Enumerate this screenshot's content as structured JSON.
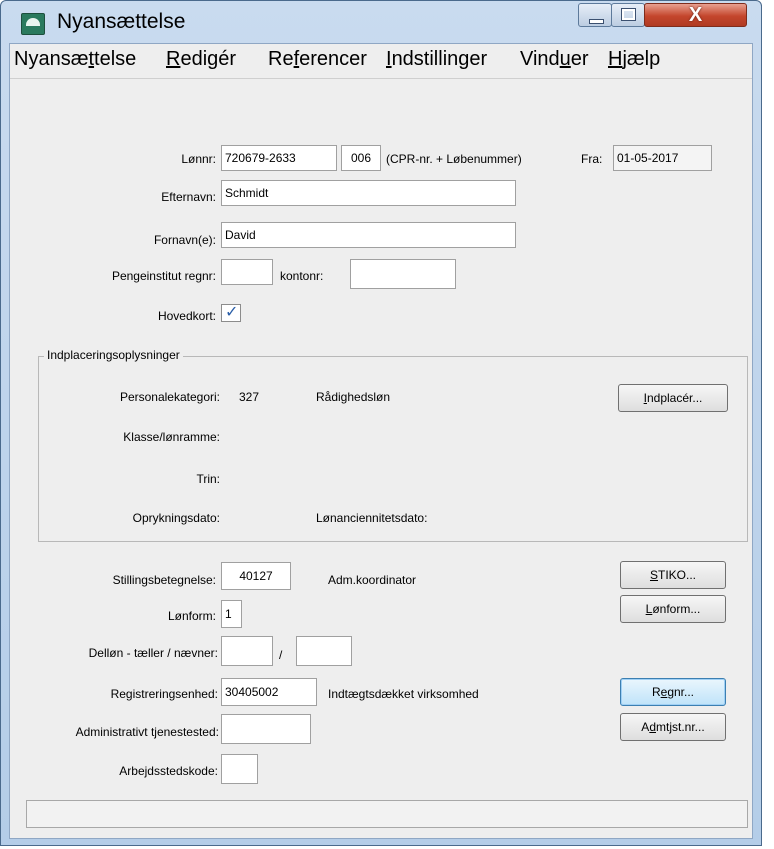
{
  "window": {
    "title": "Nyansættelse"
  },
  "menu": {
    "items": [
      {
        "pre": "Nyansæ",
        "key": "t",
        "post": "telse"
      },
      {
        "pre": "",
        "key": "R",
        "post": "edigér"
      },
      {
        "pre": "Re",
        "key": "f",
        "post": "erencer"
      },
      {
        "pre": "",
        "key": "I",
        "post": "ndstillinger"
      },
      {
        "pre": "Vind",
        "key": "u",
        "post": "er"
      },
      {
        "pre": "",
        "key": "H",
        "post": "jælp"
      }
    ]
  },
  "form": {
    "lonnr_label": "Lønnr:",
    "lonnr_value": "720679-2633",
    "lobenr_value": "006",
    "cpr_hint": "(CPR-nr. + Løbenummer)",
    "fra_label": "Fra:",
    "fra_value": "01-05-2017",
    "efternavn_label": "Efternavn:",
    "efternavn_value": "Schmidt",
    "fornavn_label": "Fornavn(e):",
    "fornavn_value": "David",
    "pengeinstitut_label": "Pengeinstitut regnr:",
    "pengeinstitut_value": "",
    "kontonr_label": "kontonr:",
    "kontonr_value": "",
    "hovedkort_label": "Hovedkort:",
    "hovedkort_checked": true
  },
  "placement": {
    "group_title": "Indplaceringsoplysninger",
    "personalekategori_label": "Personalekategori:",
    "personalekategori_code": "327",
    "personalekategori_name": "Rådighedsløn",
    "indplacer_button": {
      "key": "I",
      "rest": "ndplacér..."
    },
    "klasse_label": "Klasse/lønramme:",
    "trin_label": "Trin:",
    "oprykningsdato_label": "Oprykningsdato:",
    "lonanciennitetsdato_label": "Lønanciennitetsdato:"
  },
  "position": {
    "stilling_label": "Stillingsbetegnelse:",
    "stilling_code": "40127",
    "stilling_name": "Adm.koordinator",
    "stiko_button": {
      "key": "S",
      "rest": "TIKO..."
    },
    "lonform_label": "Lønform:",
    "lonform_value": "1",
    "lonform_button": {
      "key": "L",
      "rest": "ønform..."
    },
    "dellon_label": "Delløn - tæller / nævner:",
    "dellon_separator": "/",
    "dellon_taeller": "",
    "dellon_naevner": "",
    "registrering_label": "Registreringsenhed:",
    "registrering_code": "30405002",
    "registrering_name": "Indtægtsdækket virksomhed",
    "regnr_button": {
      "pre": "R",
      "key": "e",
      "rest": "gnr..."
    },
    "admtjst_label": "Administrativt tjenestested:",
    "admtjst_value": "",
    "admtjst_button": {
      "pre": "A",
      "key": "d",
      "rest": "mtjst.nr..."
    },
    "arbejdssted_label": "Arbejdsstedskode:",
    "arbejdssted_value": ""
  },
  "status": {
    "text": ""
  }
}
